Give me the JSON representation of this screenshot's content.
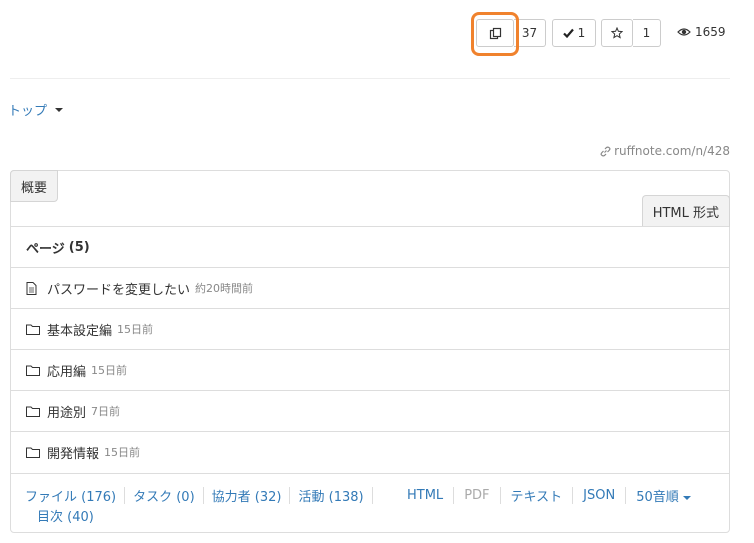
{
  "toolbar": {
    "copy_count": "37",
    "check_count": "1",
    "star_count": "1",
    "views": "1659"
  },
  "nav": {
    "top_label": "トップ"
  },
  "permalink": "ruffnote.com/n/428",
  "tabs": {
    "overview": "概要",
    "html_format": "HTML 形式"
  },
  "pages": {
    "header": "ページ",
    "count": "(5)",
    "items": [
      {
        "icon": "file-icon",
        "title": "パスワードを変更したい",
        "time": "約20時間前"
      },
      {
        "icon": "folder-icon",
        "title": "基本設定編",
        "time": "15日前"
      },
      {
        "icon": "folder-icon",
        "title": "応用編",
        "time": "15日前"
      },
      {
        "icon": "folder-icon",
        "title": "用途別",
        "time": "7日前"
      },
      {
        "icon": "folder-icon",
        "title": "開発情報",
        "time": "15日前"
      }
    ]
  },
  "footer": {
    "files": "ファイル (176)",
    "tasks": "タスク (0)",
    "collaborators": "協力者 (32)",
    "activity": "活動 (138)",
    "toc": "目次 (40)",
    "html": "HTML",
    "pdf": "PDF",
    "text": "テキスト",
    "json": "JSON",
    "sort": "50音順"
  },
  "colors": {
    "link": "#337ab7",
    "highlight": "#f0822d",
    "muted": "#888888"
  }
}
